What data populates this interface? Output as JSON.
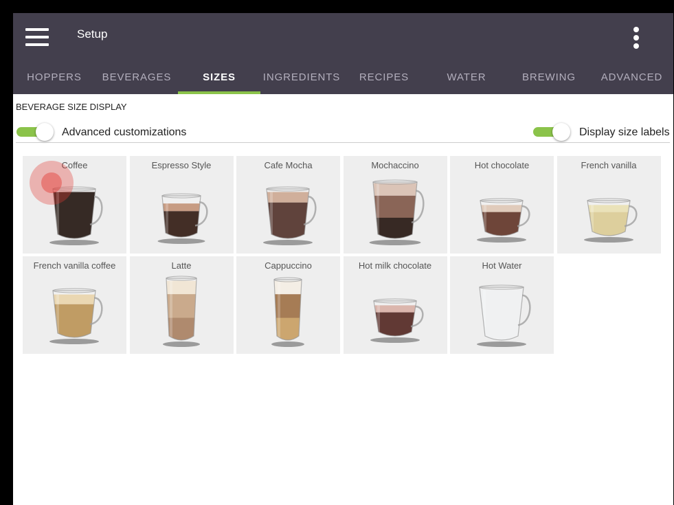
{
  "appbar": {
    "title": "Setup",
    "menu_icon": "hamburger-menu-icon",
    "overflow_icon": "more-vertical-icon"
  },
  "tabs": [
    {
      "label": "HOPPERS",
      "active": false
    },
    {
      "label": "BEVERAGES",
      "active": false
    },
    {
      "label": "SIZES",
      "active": true
    },
    {
      "label": "INGREDIENTS",
      "active": false
    },
    {
      "label": "RECIPES",
      "active": false
    },
    {
      "label": "WATER",
      "active": false
    },
    {
      "label": "BREWING",
      "active": false
    },
    {
      "label": "ADVANCED",
      "active": false
    }
  ],
  "section": {
    "title": "BEVERAGE SIZE DISPLAY"
  },
  "toggles": {
    "advanced": {
      "label": "Advanced customizations",
      "checked": true
    },
    "size_labels": {
      "label": "Display size labels",
      "checked": true
    }
  },
  "colors": {
    "appbar": "#433f4d",
    "accent": "#8bc34a",
    "tile_bg": "#eeeeee",
    "touch_indicator": "#e53935"
  },
  "beverages": [
    {
      "name": "Coffee",
      "cup": "tall-mug",
      "layers": [
        "#1b0d07"
      ]
    },
    {
      "name": "Espresso Style",
      "cup": "tall-mug-small",
      "layers": [
        "#c08f72",
        "#2a1209"
      ]
    },
    {
      "name": "Cafe Mocha",
      "cup": "tall-mug",
      "layers": [
        "#caa48e",
        "#4a2a22"
      ]
    },
    {
      "name": "Mochaccino",
      "cup": "tall-mug-full",
      "layers": [
        "#d7bcae",
        "#7a5040",
        "#1c0c06"
      ]
    },
    {
      "name": "Hot chocolate",
      "cup": "wide-mug",
      "layers": [
        "#dcc4b2",
        "#5a2c1e"
      ]
    },
    {
      "name": "French vanilla",
      "cup": "wide-mug",
      "layers": [
        "#e8deb0",
        "#d9c990"
      ]
    },
    {
      "name": "French vanilla coffee",
      "cup": "wide-mug-tall",
      "layers": [
        "#e7d2a8",
        "#b88f4f"
      ]
    },
    {
      "name": "Latte",
      "cup": "tall-glass",
      "layers": [
        "#efe3d0",
        "#c39f7d",
        "#a47a5a"
      ]
    },
    {
      "name": "Cappuccino",
      "cup": "tall-glass-narrow",
      "layers": [
        "#f3ece2",
        "#9a6a3e",
        "#c59a5c"
      ]
    },
    {
      "name": "Hot milk chocolate",
      "cup": "wide-mug",
      "layers": [
        "#d6aca2",
        "#4c1e18"
      ]
    },
    {
      "name": "Hot Water",
      "cup": "tall-mug-water",
      "layers": [
        "#eef0f1"
      ]
    }
  ]
}
